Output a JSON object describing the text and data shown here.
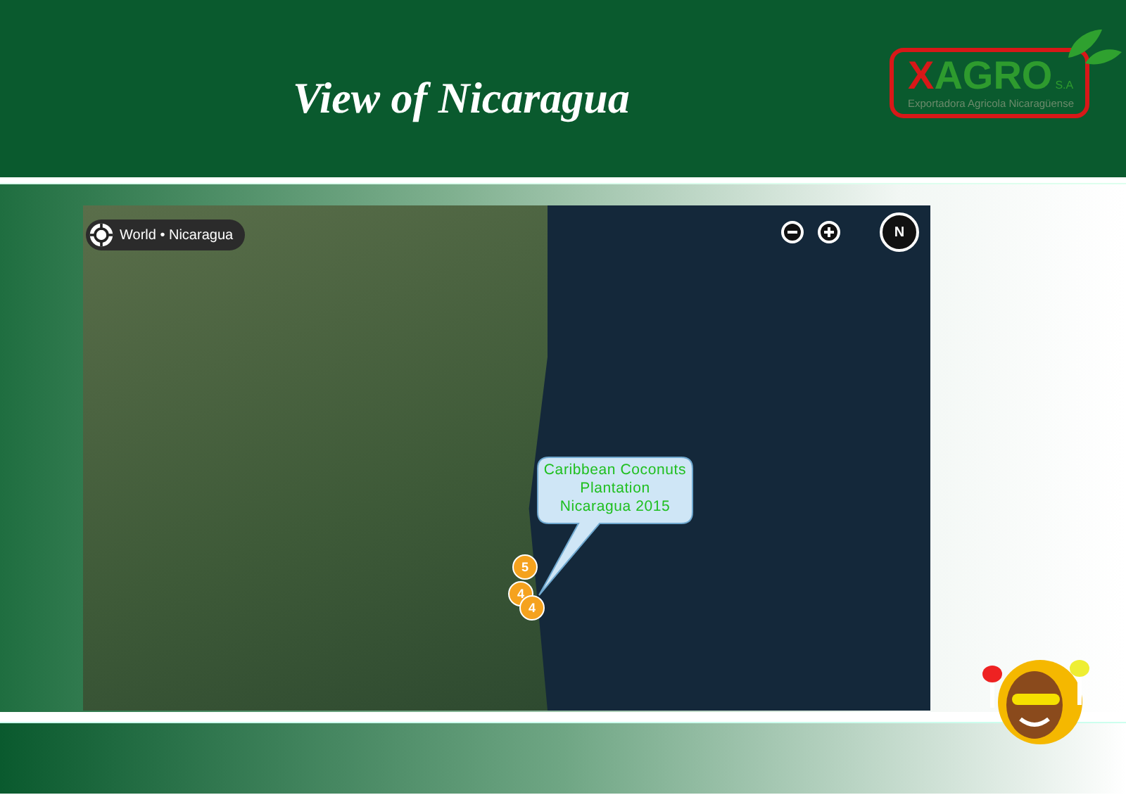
{
  "title": "View of Nicaragua",
  "logo": {
    "name": "XAGRO",
    "suffix": "S.A",
    "tagline": "Exportadora Agricola Nicaragüense"
  },
  "map": {
    "breadcrumb": "World • Nicaragua",
    "compass": "N",
    "callout": [
      "Caribbean Coconuts",
      "Plantation",
      "Nicaragua 2015"
    ],
    "markers": [
      {
        "label": "5"
      },
      {
        "label": "4"
      },
      {
        "label": "4"
      }
    ]
  }
}
